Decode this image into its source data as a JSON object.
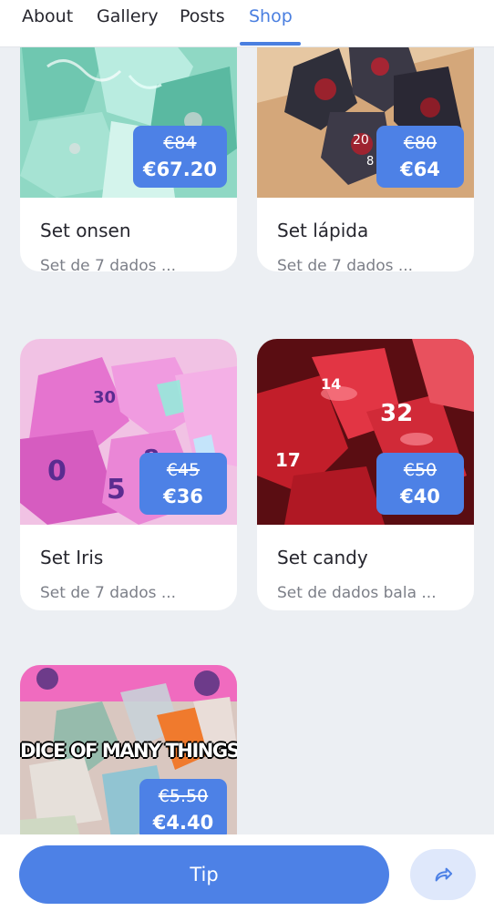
{
  "nav": {
    "tabs": [
      "About",
      "Gallery",
      "Posts",
      "Shop"
    ],
    "active": "Shop"
  },
  "products": [
    {
      "title": "Set onsen",
      "desc": "Set de 7 dados ...",
      "old_price": "€84",
      "price": "€67.20"
    },
    {
      "title": "Set lápida",
      "desc": "Set de 7 dados ...",
      "old_price": "€80",
      "price": "€64"
    },
    {
      "title": "Set Iris",
      "desc": "Set de 7 dados ...",
      "old_price": "€45",
      "price": "€36"
    },
    {
      "title": "Set candy",
      "desc": "Set de dados bala ...",
      "old_price": "€50",
      "price": "€40"
    },
    {
      "title": "",
      "desc": "",
      "old_price": "€5.50",
      "price": "€4.40",
      "image_text": "DICE OF MANY THINGS"
    }
  ],
  "bottom": {
    "tip_label": "Tip",
    "share_icon": "share-arrow-icon"
  },
  "colors": {
    "accent": "#4d81e6",
    "active_tab": "#4a7fe0",
    "page_bg": "#eceff3",
    "share_bg": "#dfe8fb"
  }
}
